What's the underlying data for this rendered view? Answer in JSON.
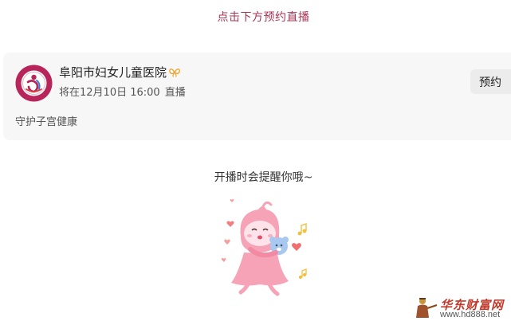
{
  "header": {
    "link_text": "点击下方预约直播"
  },
  "card": {
    "org_name": "阜阳市妇女儿童医院",
    "verified_icon": "butterfly-badge-icon",
    "schedule_prefix": "将在12月10日 16:00",
    "schedule_suffix": "直播",
    "description": "守护子宫健康",
    "reserve_label": "预约"
  },
  "reminder": {
    "text": "开播时会提醒你哦~"
  },
  "watermark": {
    "title": "华东财富网",
    "url": "www.hd888.net"
  },
  "colors": {
    "accent": "#a83454",
    "card_bg": "#f7f7f7",
    "button_bg": "#ececec",
    "mascot_pink": "#f6a3b8"
  }
}
